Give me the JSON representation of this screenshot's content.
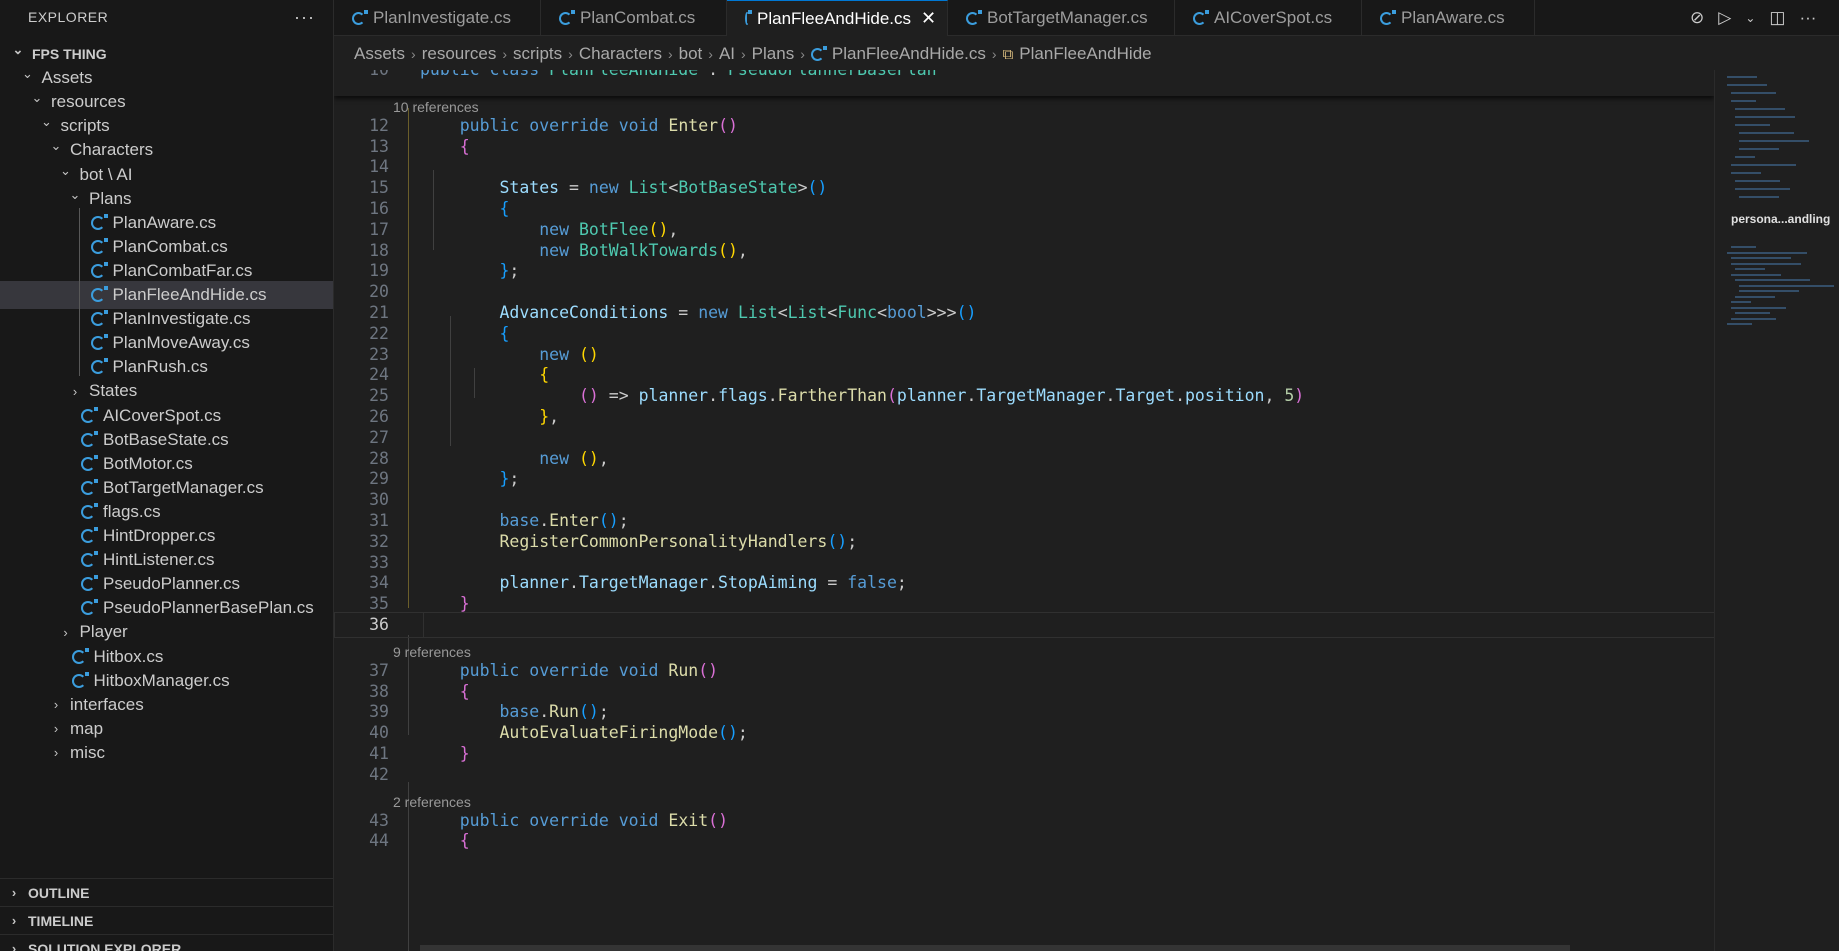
{
  "sidebar": {
    "title": "EXPLORER",
    "more_label": "···",
    "tree": [
      {
        "label": "FPS THING",
        "depth": 0,
        "kind": "root",
        "chev": "open"
      },
      {
        "label": "Assets",
        "depth": 1,
        "kind": "folder",
        "chev": "open"
      },
      {
        "label": "resources",
        "depth": 2,
        "kind": "folder",
        "chev": "open"
      },
      {
        "label": "scripts",
        "depth": 3,
        "kind": "folder",
        "chev": "open"
      },
      {
        "label": "Characters",
        "depth": 4,
        "kind": "folder",
        "chev": "open"
      },
      {
        "label": "bot \\ AI",
        "depth": 5,
        "kind": "folder",
        "chev": "open"
      },
      {
        "label": "Plans",
        "depth": 6,
        "kind": "folder",
        "chev": "open"
      },
      {
        "label": "PlanAware.cs",
        "depth": 7,
        "kind": "file"
      },
      {
        "label": "PlanCombat.cs",
        "depth": 7,
        "kind": "file"
      },
      {
        "label": "PlanCombatFar.cs",
        "depth": 7,
        "kind": "file"
      },
      {
        "label": "PlanFleeAndHide.cs",
        "depth": 7,
        "kind": "file",
        "selected": true
      },
      {
        "label": "PlanInvestigate.cs",
        "depth": 7,
        "kind": "file"
      },
      {
        "label": "PlanMoveAway.cs",
        "depth": 7,
        "kind": "file"
      },
      {
        "label": "PlanRush.cs",
        "depth": 7,
        "kind": "file"
      },
      {
        "label": "States",
        "depth": 6,
        "kind": "folder",
        "chev": "closed"
      },
      {
        "label": "AICoverSpot.cs",
        "depth": 6,
        "kind": "file"
      },
      {
        "label": "BotBaseState.cs",
        "depth": 6,
        "kind": "file"
      },
      {
        "label": "BotMotor.cs",
        "depth": 6,
        "kind": "file"
      },
      {
        "label": "BotTargetManager.cs",
        "depth": 6,
        "kind": "file"
      },
      {
        "label": "flags.cs",
        "depth": 6,
        "kind": "file"
      },
      {
        "label": "HintDropper.cs",
        "depth": 6,
        "kind": "file"
      },
      {
        "label": "HintListener.cs",
        "depth": 6,
        "kind": "file"
      },
      {
        "label": "PseudoPlanner.cs",
        "depth": 6,
        "kind": "file"
      },
      {
        "label": "PseudoPlannerBasePlan.cs",
        "depth": 6,
        "kind": "file"
      },
      {
        "label": "Player",
        "depth": 5,
        "kind": "folder",
        "chev": "closed"
      },
      {
        "label": "Hitbox.cs",
        "depth": 5,
        "kind": "file"
      },
      {
        "label": "HitboxManager.cs",
        "depth": 5,
        "kind": "file"
      },
      {
        "label": "interfaces",
        "depth": 4,
        "kind": "folder",
        "chev": "closed"
      },
      {
        "label": "map",
        "depth": 4,
        "kind": "folder",
        "chev": "closed"
      },
      {
        "label": "misc",
        "depth": 4,
        "kind": "folder",
        "chev": "closed"
      }
    ],
    "sections": [
      "OUTLINE",
      "TIMELINE",
      "SOLUTION EXPLORER"
    ]
  },
  "tabs": [
    {
      "label": "PlanInvestigate.cs"
    },
    {
      "label": "PlanCombat.cs"
    },
    {
      "label": "PlanFleeAndHide.cs",
      "active": true
    },
    {
      "label": "BotTargetManager.cs"
    },
    {
      "label": "AICoverSpot.cs"
    },
    {
      "label": "PlanAware.cs"
    }
  ],
  "tab_close_glyph": "✕",
  "breadcrumb": [
    "Assets",
    "resources",
    "scripts",
    "Characters",
    "bot",
    "AI",
    "Plans",
    "PlanFleeAndHide.cs",
    "PlanFleeAndHide"
  ],
  "editor": {
    "current_line": "36",
    "lines": [
      {
        "n": "10",
        "html": "<span class='k'>public</span> <span class='k'>class</span> <span class='t'>PlanFleeAndHide</span> : <span class='t'>PseudoPlannerBasePlan</span>"
      },
      {
        "lens": "10 references"
      },
      {
        "n": "12",
        "html": "    <span class='k'>public</span> <span class='k'>override</span> <span class='k'>void</span> <span class='f'>Enter</span><span class='b2'>()</span>"
      },
      {
        "n": "13",
        "html": "    <span class='b2'>{</span>"
      },
      {
        "n": "14",
        "html": ""
      },
      {
        "n": "15",
        "html": "        <span class='v'>States</span> = <span class='k'>new</span> <span class='t'>List</span>&lt;<span class='t'>BotBaseState</span>&gt;<span class='b3'>()</span>"
      },
      {
        "n": "16",
        "html": "        <span class='b3'>{</span>"
      },
      {
        "n": "17",
        "html": "            <span class='k'>new</span> <span class='t'>BotFlee</span><span class='b1'>()</span>,"
      },
      {
        "n": "18",
        "html": "            <span class='k'>new</span> <span class='t'>BotWalkTowards</span><span class='b1'>()</span>,"
      },
      {
        "n": "19",
        "html": "        <span class='b3'>}</span>;"
      },
      {
        "n": "20",
        "html": ""
      },
      {
        "n": "21",
        "html": "        <span class='v'>AdvanceConditions</span> = <span class='k'>new</span> <span class='t'>List</span>&lt;<span class='t'>List</span>&lt;<span class='t'>Func</span>&lt;<span class='k'>bool</span>&gt;&gt;&gt;<span class='b3'>()</span>"
      },
      {
        "n": "22",
        "html": "        <span class='b3'>{</span>"
      },
      {
        "n": "23",
        "html": "            <span class='k'>new</span> <span class='b1'>()</span>"
      },
      {
        "n": "24",
        "html": "            <span class='b1'>{</span>"
      },
      {
        "n": "25",
        "html": "                <span class='b2'>()</span> =&gt; <span class='v'>planner</span>.<span class='v'>flags</span>.<span class='f'>FartherThan</span><span class='b2'>(</span><span class='v'>planner</span>.<span class='v'>TargetManager</span>.<span class='v'>Target</span>.<span class='v'>position</span>, <span class='n'>5</span><span class='b2'>)</span>"
      },
      {
        "n": "26",
        "html": "            <span class='b1'>}</span>,"
      },
      {
        "n": "27",
        "html": ""
      },
      {
        "n": "28",
        "html": "            <span class='k'>new</span> <span class='b1'>()</span>,"
      },
      {
        "n": "29",
        "html": "        <span class='b3'>}</span>;"
      },
      {
        "n": "30",
        "html": ""
      },
      {
        "n": "31",
        "html": "        <span class='k'>base</span>.<span class='f'>Enter</span><span class='b3'>()</span>;"
      },
      {
        "n": "32",
        "html": "        <span class='f'>RegisterCommonPersonalityHandlers</span><span class='b3'>()</span>;"
      },
      {
        "n": "33",
        "html": ""
      },
      {
        "n": "34",
        "html": "        <span class='v'>planner</span>.<span class='v'>TargetManager</span>.<span class='v'>StopAiming</span> = <span class='k'>false</span>;"
      },
      {
        "n": "35",
        "html": "    <span class='b2'>}</span>"
      },
      {
        "n": "36",
        "html": "",
        "current": true
      },
      {
        "lens": "9 references"
      },
      {
        "n": "37",
        "html": "    <span class='k'>public</span> <span class='k'>override</span> <span class='k'>void</span> <span class='f'>Run</span><span class='b2'>()</span>"
      },
      {
        "n": "38",
        "html": "    <span class='b2'>{</span>"
      },
      {
        "n": "39",
        "html": "        <span class='k'>base</span>.<span class='f'>Run</span><span class='b3'>()</span>;"
      },
      {
        "n": "40",
        "html": "        <span class='f'>AutoEvaluateFiringMode</span><span class='b3'>()</span>;"
      },
      {
        "n": "41",
        "html": "    <span class='b2'>}</span>"
      },
      {
        "n": "42",
        "html": ""
      },
      {
        "lens": "2 references"
      },
      {
        "n": "43",
        "html": "    <span class='k'>public</span> <span class='k'>override</span> <span class='k'>void</span> <span class='f'>Exit</span><span class='b2'>()</span>"
      },
      {
        "n": "44",
        "html": "    <span class='b2'>{</span>"
      }
    ]
  },
  "minimap": {
    "label": "persona...andling"
  }
}
